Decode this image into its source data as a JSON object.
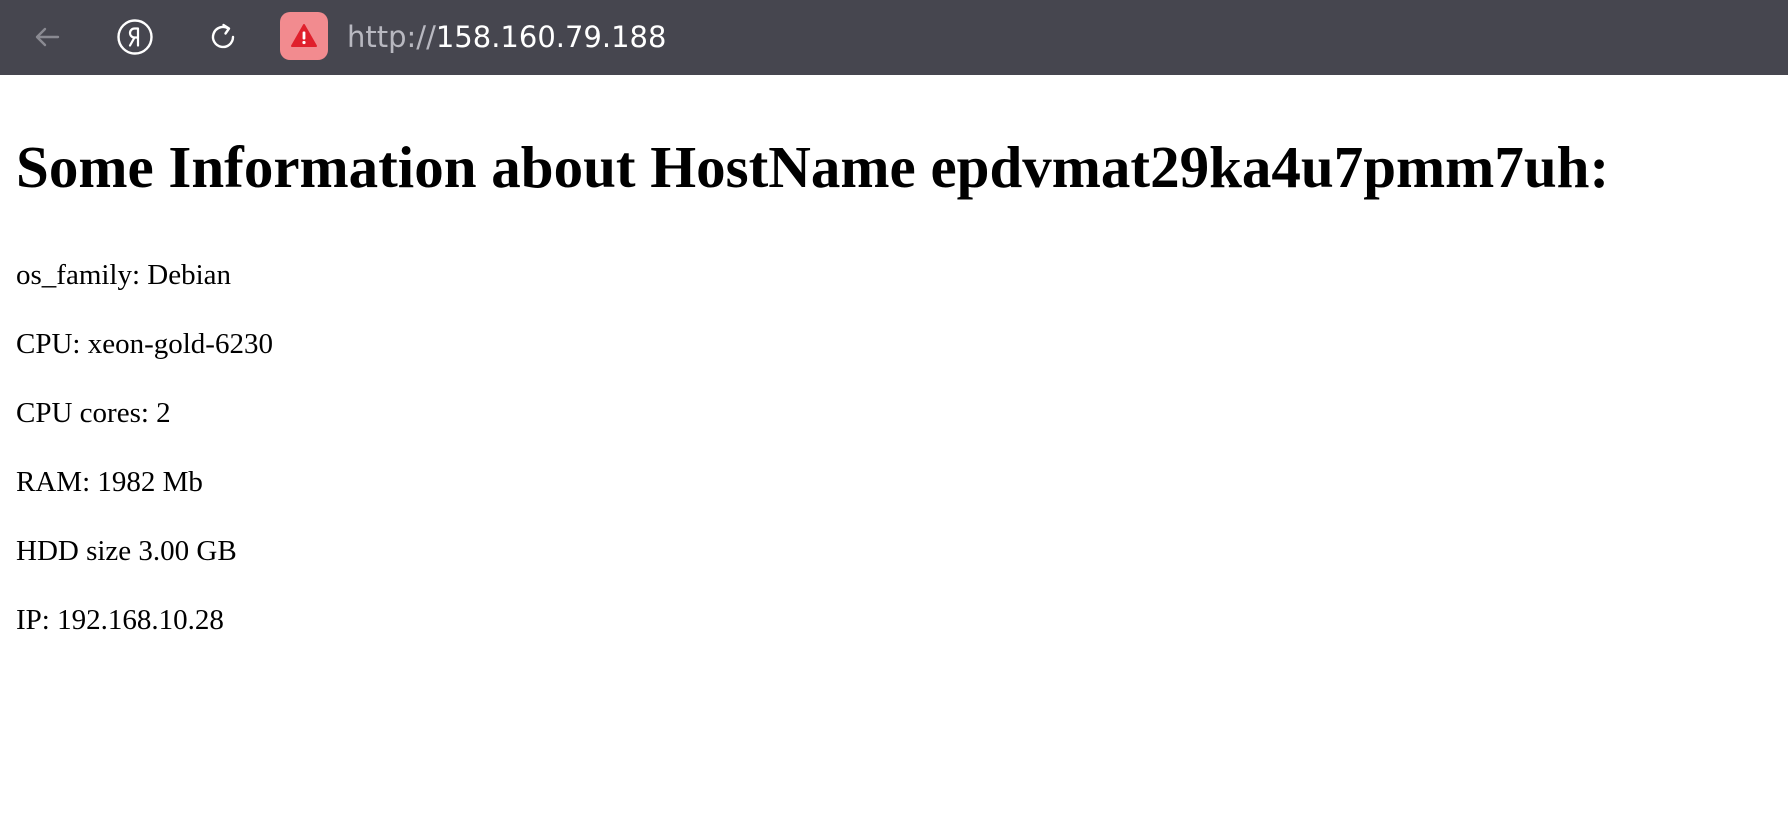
{
  "browser": {
    "url_scheme": "http://",
    "url_host": "158.160.79.188",
    "back_icon": "arrow-left-icon",
    "yandex_icon": "yandex-logo-icon",
    "reload_icon": "reload-icon",
    "security_icon": "warning-triangle-icon",
    "toolbar_color": "#46464f",
    "warning_color": "#f28b8f"
  },
  "page": {
    "title": "Some Information about HostName epdvmat29ka4u7pmm7uh:",
    "lines": [
      "os_family: Debian",
      "CPU: xeon-gold-6230",
      "CPU cores: 2",
      "RAM: 1982 Mb",
      "HDD size 3.00 GB",
      "IP: 192.168.10.28"
    ]
  }
}
